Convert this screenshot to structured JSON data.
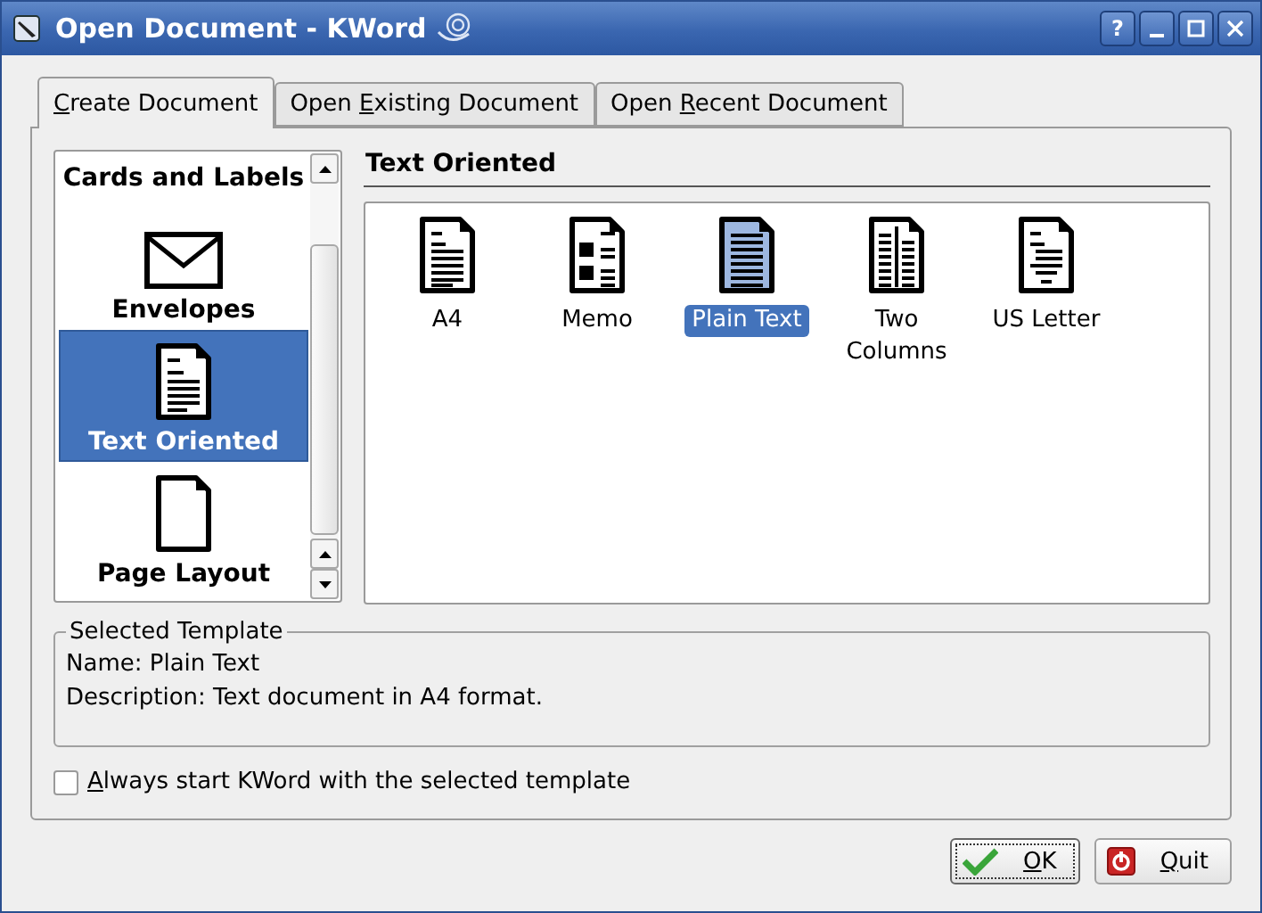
{
  "window": {
    "title": "Open Document - KWord",
    "help_button": "?"
  },
  "tabs": [
    {
      "accel": "C",
      "post": "reate Document",
      "selected": true
    },
    {
      "pre": "Open ",
      "accel": "E",
      "post": "xisting Document",
      "selected": false
    },
    {
      "pre": "Open ",
      "accel": "R",
      "post": "ecent Document",
      "selected": false
    }
  ],
  "categories": [
    {
      "label": "Cards and Labels",
      "kind": "none",
      "selected": false
    },
    {
      "label": "Envelopes",
      "kind": "envelope",
      "selected": false
    },
    {
      "label": "Text Oriented",
      "kind": "text",
      "selected": true
    },
    {
      "label": "Page Layout",
      "kind": "blank",
      "selected": false
    }
  ],
  "section_title": "Text Oriented",
  "templates": [
    {
      "label": "A4",
      "kind": "a4",
      "selected": false
    },
    {
      "label": "Memo",
      "kind": "memo",
      "selected": false
    },
    {
      "label": "Plain Text",
      "kind": "plain",
      "selected": true
    },
    {
      "label": "Two Columns",
      "kind": "columns",
      "selected": false
    },
    {
      "label": "US Letter",
      "kind": "letter",
      "selected": false
    }
  ],
  "selected_template": {
    "title": "Selected Template",
    "name": "Name: Plain Text",
    "description": "Description: Text document in A4 format."
  },
  "always_start": {
    "accel": "A",
    "post": "lways start KWord with the selected template",
    "checked": false
  },
  "buttons": [
    {
      "accel": "O",
      "post": "K",
      "kind": "ok",
      "focused": true
    },
    {
      "accel": "Q",
      "post": "uit",
      "kind": "quit",
      "focused": false
    }
  ]
}
